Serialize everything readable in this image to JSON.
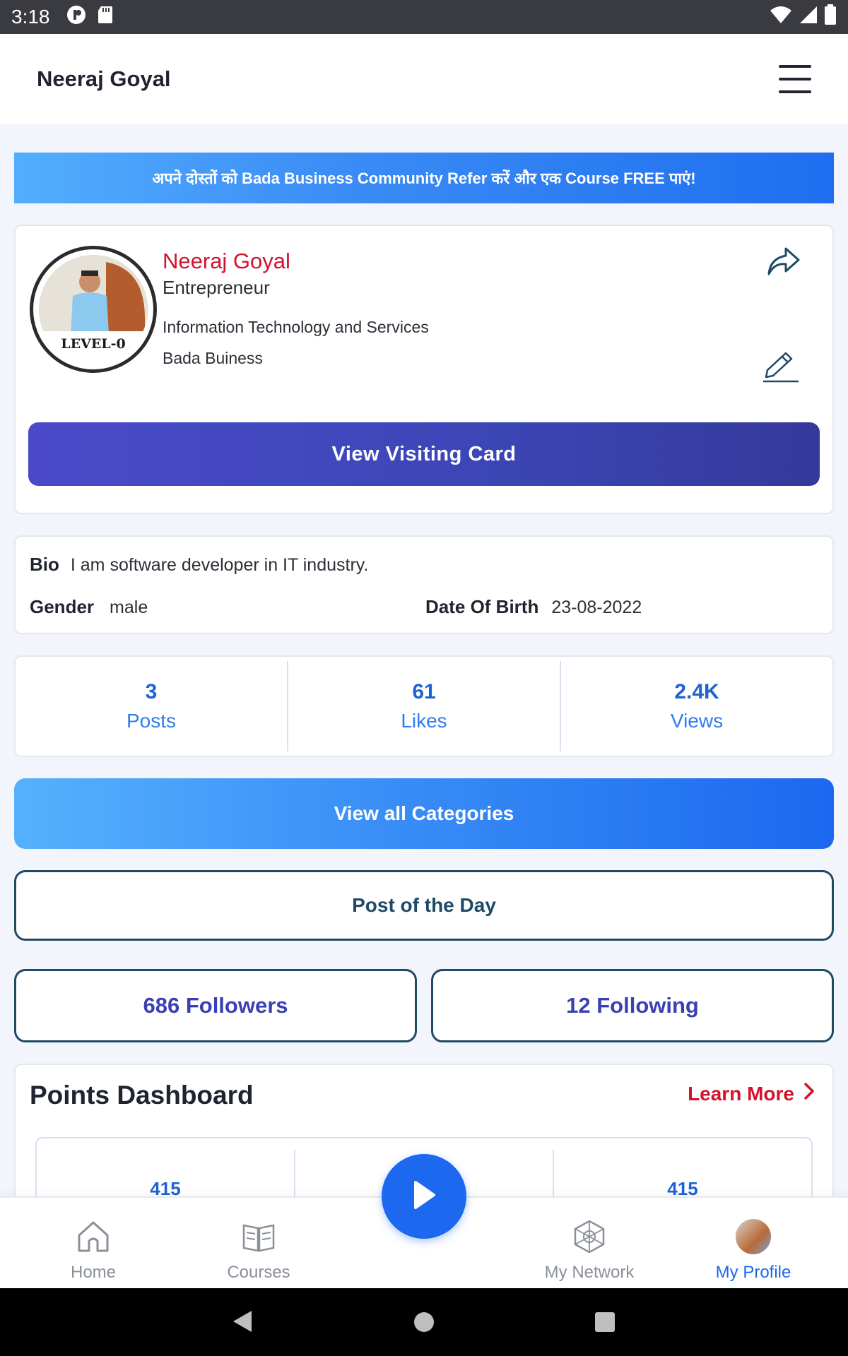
{
  "status_bar": {
    "time": "3:18"
  },
  "app_bar": {
    "title": "Neeraj Goyal"
  },
  "banner": {
    "text": "अपने दोस्तों को Bada Business Community Refer करें और एक Course FREE पाएं!"
  },
  "profile": {
    "name": "Neeraj Goyal",
    "role": "Entrepreneur",
    "industry": "Information Technology and Services",
    "company": "Bada Buiness",
    "level_badge": "LEVEL-0",
    "visiting_card_button": "View Visiting Card"
  },
  "bio": {
    "bio_label": "Bio",
    "bio_value": "I am software developer in IT industry.",
    "gender_label": "Gender",
    "gender_value": "male",
    "dob_label": "Date Of Birth",
    "dob_value": "23-08-2022"
  },
  "stats": [
    {
      "value": "3",
      "label": "Posts"
    },
    {
      "value": "61",
      "label": "Likes"
    },
    {
      "value": "2.4K",
      "label": "Views"
    }
  ],
  "actions": {
    "view_all_categories": "View all Categories",
    "post_of_the_day": "Post of the Day",
    "followers": "686 Followers",
    "following": "12 Following"
  },
  "points_dashboard": {
    "title": "Points Dashboard",
    "learn_more": "Learn More",
    "values": [
      "415",
      "",
      "415"
    ]
  },
  "bottom_nav": [
    {
      "label": "Home",
      "icon": "home-icon"
    },
    {
      "label": "Courses",
      "icon": "courses-icon"
    },
    {
      "label": "My Network",
      "icon": "network-icon"
    },
    {
      "label": "My Profile",
      "icon": "profile-avatar",
      "active": true
    }
  ],
  "colors": {
    "accent_blue": "#1c68ef",
    "name_red": "#d2132c",
    "visiting_card_purple": "#3b46b5",
    "outline_navy": "#1e4a66"
  }
}
